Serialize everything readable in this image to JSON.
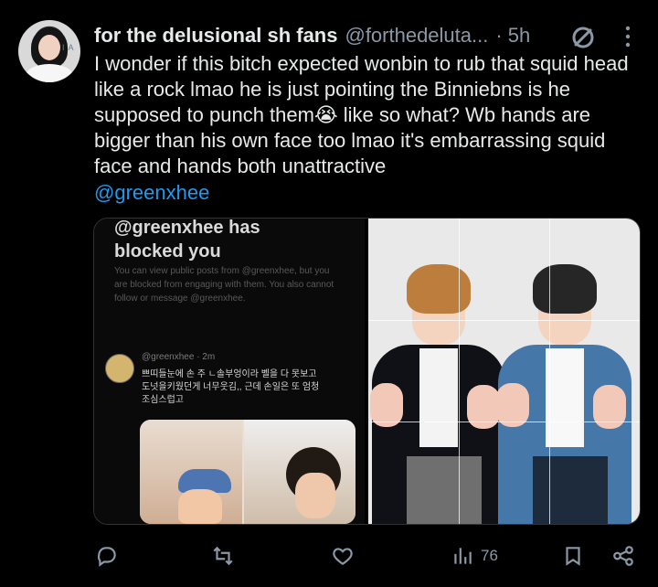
{
  "post": {
    "author_name": "for the delusional sh fans",
    "handle": "@forthedeluta...",
    "timestamp": "· 5h",
    "text": "I wonder if this bitch expected wonbin to rub that squid head like a rock lmao he is just pointing the Binniebns is he supposed to punch them😭 like so what? Wb hands are bigger than his own face too lmao it's embarrassing squid face and hands both unattractive",
    "mention": "@greenxhee"
  },
  "media": {
    "left": {
      "title": "@greenxhee has\nblocked you",
      "notice": "You can view public posts from @greenxhee, but you are blocked from engaging with them. You also cannot follow or message @greenxhee.",
      "inner_meta": "@greenxhee · 2m",
      "inner_text": "쁘띠들눈에 손 주 ㄴ솔부엉이라 벨을 다 못보고\n도넛을키웠던게 너무웃김,, 근데 손일은 또 엄청\n조심스럽고"
    }
  },
  "actions": {
    "view_count": "76"
  },
  "icons": {
    "reply": "reply-icon",
    "repost": "repost-icon",
    "like": "like-icon",
    "views": "views-icon",
    "bookmark": "bookmark-icon",
    "share": "share-icon",
    "grok": "grok-icon",
    "more": "more-icon"
  },
  "colors": {
    "background": "#000000",
    "text": "#e7e9ea",
    "muted": "#8b98a5",
    "accent": "#1d9bf0"
  }
}
